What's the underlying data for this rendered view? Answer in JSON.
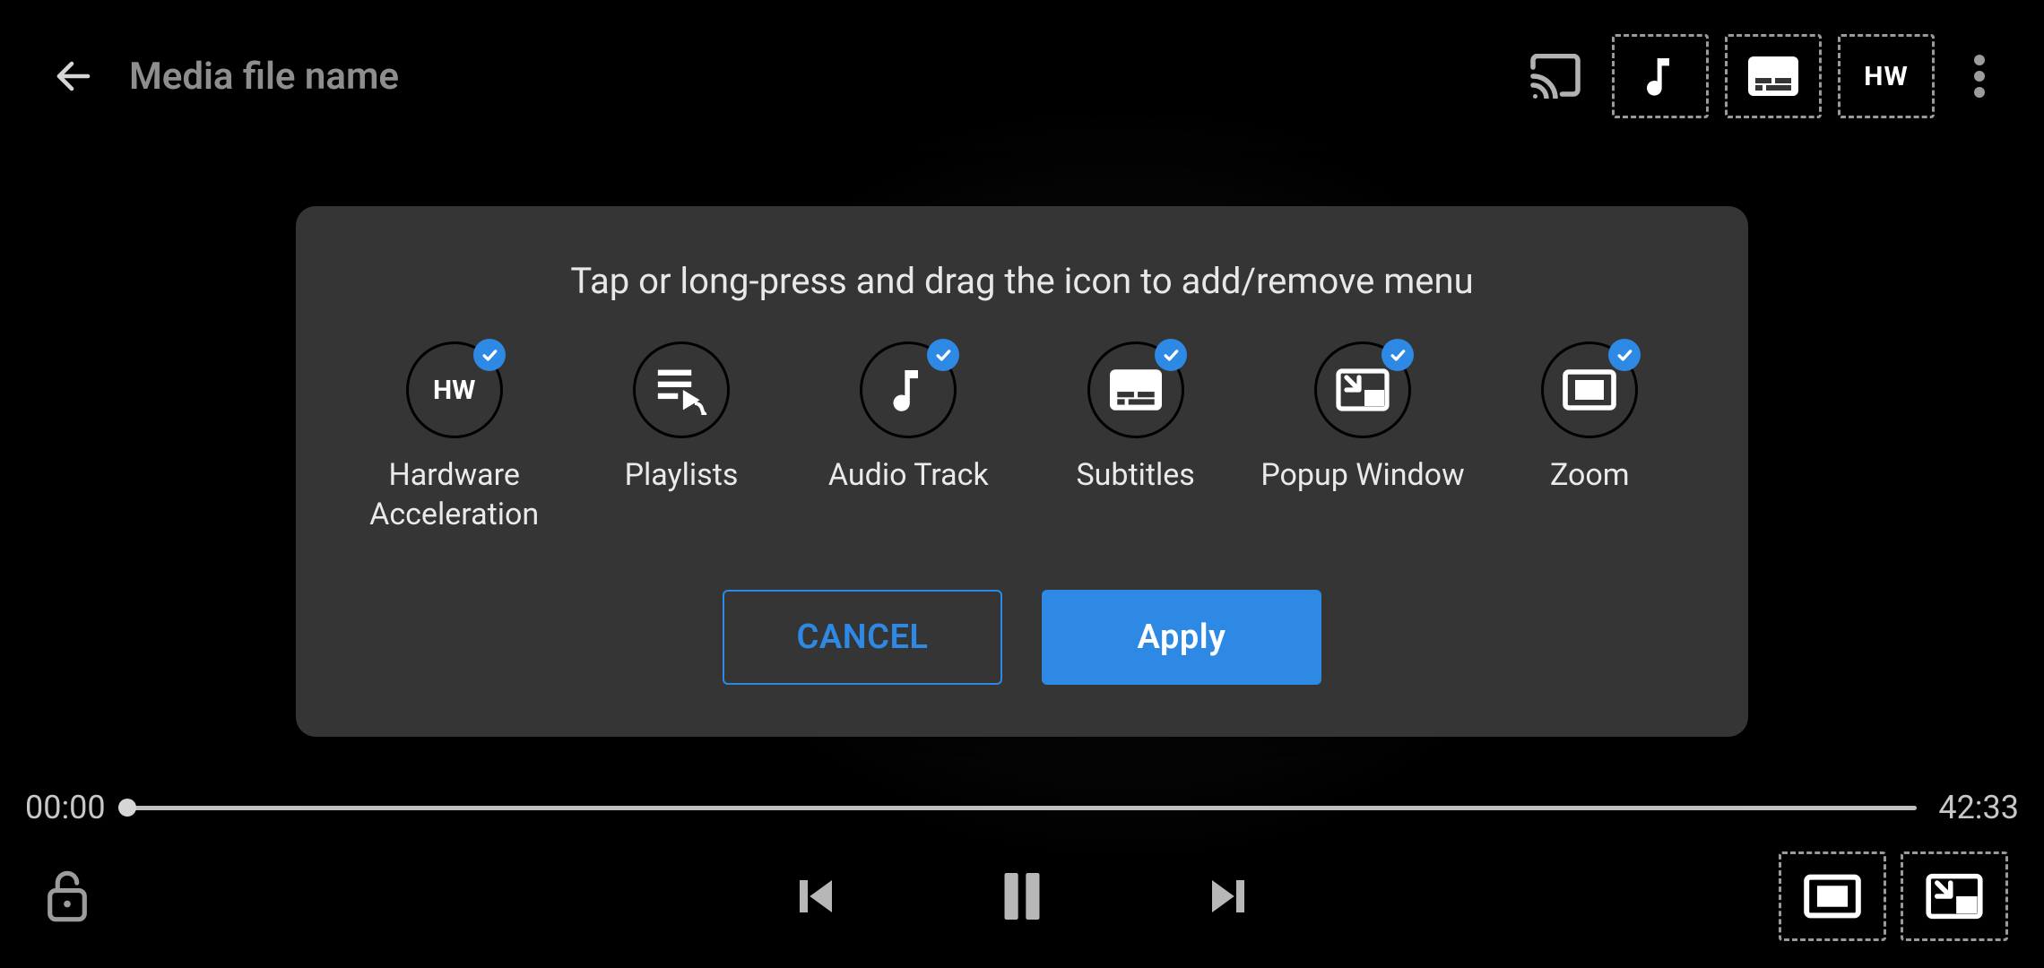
{
  "header": {
    "title": "Media file name",
    "hw_label": "HW"
  },
  "dialog": {
    "instruction": "Tap or long-press and drag the icon to add/remove menu",
    "options": [
      {
        "label": "Hardware Acceleration"
      },
      {
        "label": "Playlists"
      },
      {
        "label": "Audio Track"
      },
      {
        "label": "Subtitles"
      },
      {
        "label": "Popup Window"
      },
      {
        "label": "Zoom"
      }
    ],
    "cancel_label": "CANCEL",
    "apply_label": "Apply",
    "hw_inner": "HW"
  },
  "playback": {
    "current_time": "00:00",
    "duration": "42:33"
  }
}
